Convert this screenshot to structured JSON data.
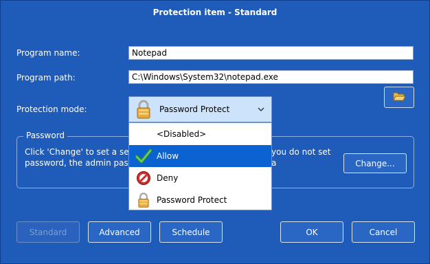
{
  "window": {
    "title": "Protection item - Standard"
  },
  "form": {
    "program_name_label": "Program name:",
    "program_name_value": "Notepad",
    "program_path_label": "Program path:",
    "program_path_value": "C:\\Windows\\System32\\notepad.exe",
    "protection_mode_label": "Protection mode:",
    "protection_mode_value": "Password Protect",
    "browse_icon": "folder-open-icon"
  },
  "dropdown": {
    "items": [
      {
        "label": "<Disabled>",
        "icon": "none"
      },
      {
        "label": "Allow",
        "icon": "checkmark-icon",
        "selected": true
      },
      {
        "label": "Deny",
        "icon": "no-entry-icon"
      },
      {
        "label": "Password Protect",
        "icon": "padlock-icon"
      }
    ]
  },
  "password_group": {
    "title": "Password",
    "description_visible_left": "Click 'Change' to set a separa",
    "description_visible_right": "you do not set a",
    "description_line2": "password, the admin passwo",
    "change_button": "Change..."
  },
  "footer": {
    "standard": "Standard",
    "advanced": "Advanced",
    "schedule": "Schedule",
    "ok": "OK",
    "cancel": "Cancel"
  },
  "colors": {
    "window_bg": "#1f5bb9",
    "selected_item_bg": "#0a63d0",
    "combo_bg": "#cde3fb"
  }
}
